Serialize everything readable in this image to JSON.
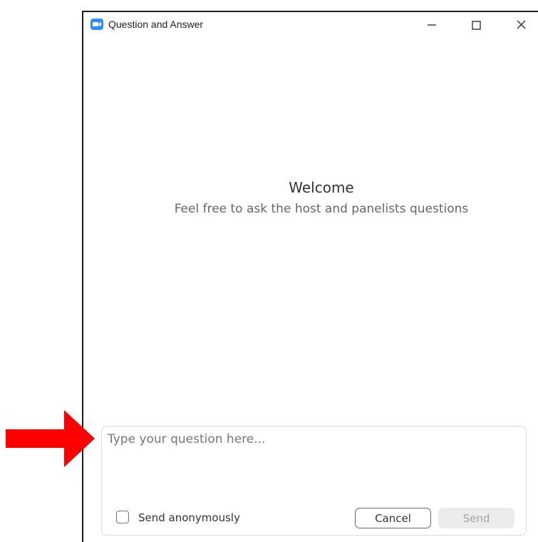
{
  "window": {
    "title": "Question and Answer",
    "app_icon": "zoom-camera-icon",
    "controls": [
      "minimize-icon",
      "maximize-icon",
      "close-icon"
    ]
  },
  "welcome": {
    "title": "Welcome",
    "subtitle": "Feel free to ask the host and panelists questions"
  },
  "composer": {
    "input_value": "",
    "input_placeholder": "Type your question here...",
    "anonymous_label": "Send anonymously",
    "anonymous_checked": false,
    "cancel_label": "Cancel",
    "send_label": "Send",
    "send_enabled": false
  },
  "annotation": {
    "arrow_icon": "red-arrow-icon",
    "arrow_color": "#ff0000"
  },
  "colors": {
    "brand": "#2d8cff",
    "send_disabled_bg": "#ececec"
  }
}
